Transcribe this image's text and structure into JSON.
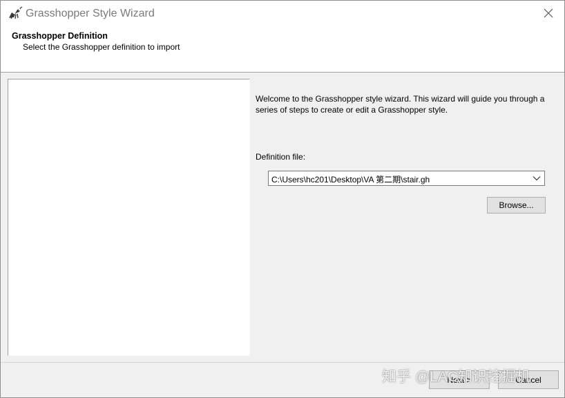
{
  "window": {
    "title": "Grasshopper Style Wizard",
    "icon": "grasshopper-app-icon",
    "close_icon": "close-icon"
  },
  "header": {
    "title": "Grasshopper Definition",
    "subtitle": "Select the Grasshopper definition to import"
  },
  "main": {
    "welcome_text": "Welcome to the Grasshopper style wizard. This wizard will guide you through a series of steps to create or edit a Grasshopper style.",
    "definition_label": "Definition file:",
    "definition_value": "C:\\Users\\hc201\\Desktop\\VA 第二期\\stair.gh",
    "browse_label": "Browse..."
  },
  "footer": {
    "next_label": "Next >",
    "cancel_label": "Cancel"
  },
  "watermark": {
    "text": "知乎 @LAC知识挖掘机"
  },
  "colors": {
    "dialog_bg": "#f0f0f0",
    "header_bg": "#ffffff",
    "button_bg": "#e1e1e1",
    "button_border": "#adadad",
    "title_text": "#7a7a7a"
  }
}
